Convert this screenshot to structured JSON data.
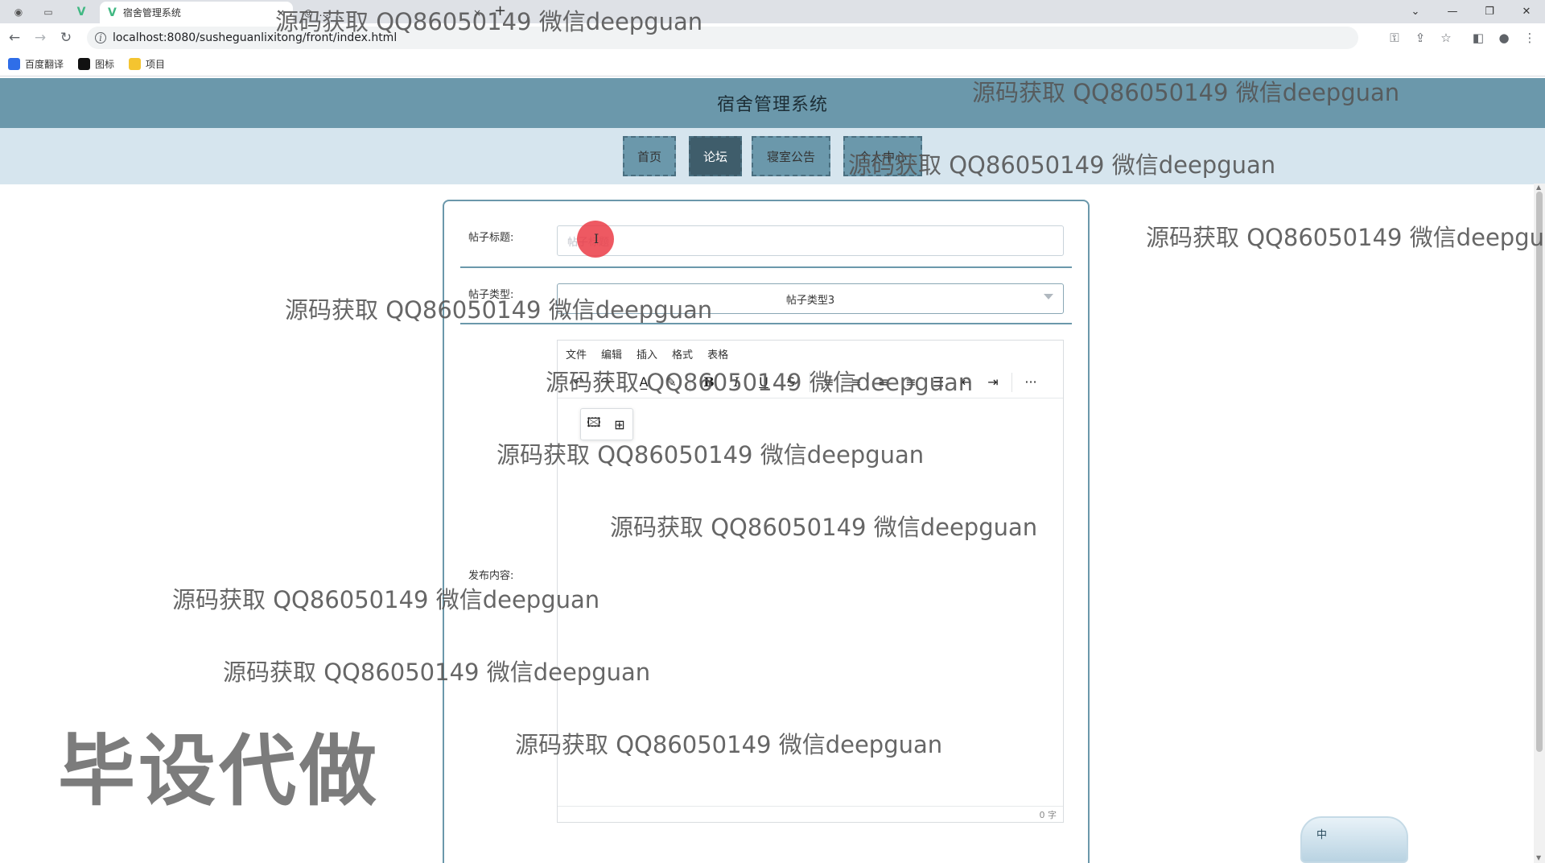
{
  "browser": {
    "tab_title": "宿舍管理系统",
    "tab_close": "×",
    "second_tab_title": "…",
    "new_tab": "+",
    "url": "localhost:8080/susheguanlixitong/front/index.html",
    "bookmarks": [
      {
        "label": "百度翻译",
        "icon": "translate-icon",
        "color": "#2f6ee8"
      },
      {
        "label": "图标",
        "icon": "image-icon",
        "color": "#111111"
      },
      {
        "label": "项目",
        "icon": "folder-icon",
        "color": "#f4c430"
      }
    ]
  },
  "site": {
    "title": "宿舍管理系统",
    "nav": [
      {
        "label": "首页",
        "active": false
      },
      {
        "label": "论坛",
        "active": true
      },
      {
        "label": "寝室公告",
        "active": false
      },
      {
        "label": "个人中心",
        "active": false
      }
    ],
    "colors": {
      "header": "#6b98ab",
      "nav_bg": "#d6e5ee",
      "active": "#3f5d6b"
    }
  },
  "form": {
    "title_label": "帖子标题:",
    "title_placeholder": "帖子标题",
    "type_label": "帖子类型:",
    "type_value": "帖子类型3",
    "content_label": "发布内容:",
    "editor": {
      "menus": [
        "文件",
        "编辑",
        "插入",
        "格式",
        "表格"
      ],
      "word_count": "0 字"
    }
  },
  "watermarks": {
    "text": "源码获取 QQ86050149 微信deepguan",
    "text_cut": "源码获取 QQ86050149 微信deepgu",
    "big": "毕设代做"
  },
  "ime": {
    "label": "中"
  }
}
